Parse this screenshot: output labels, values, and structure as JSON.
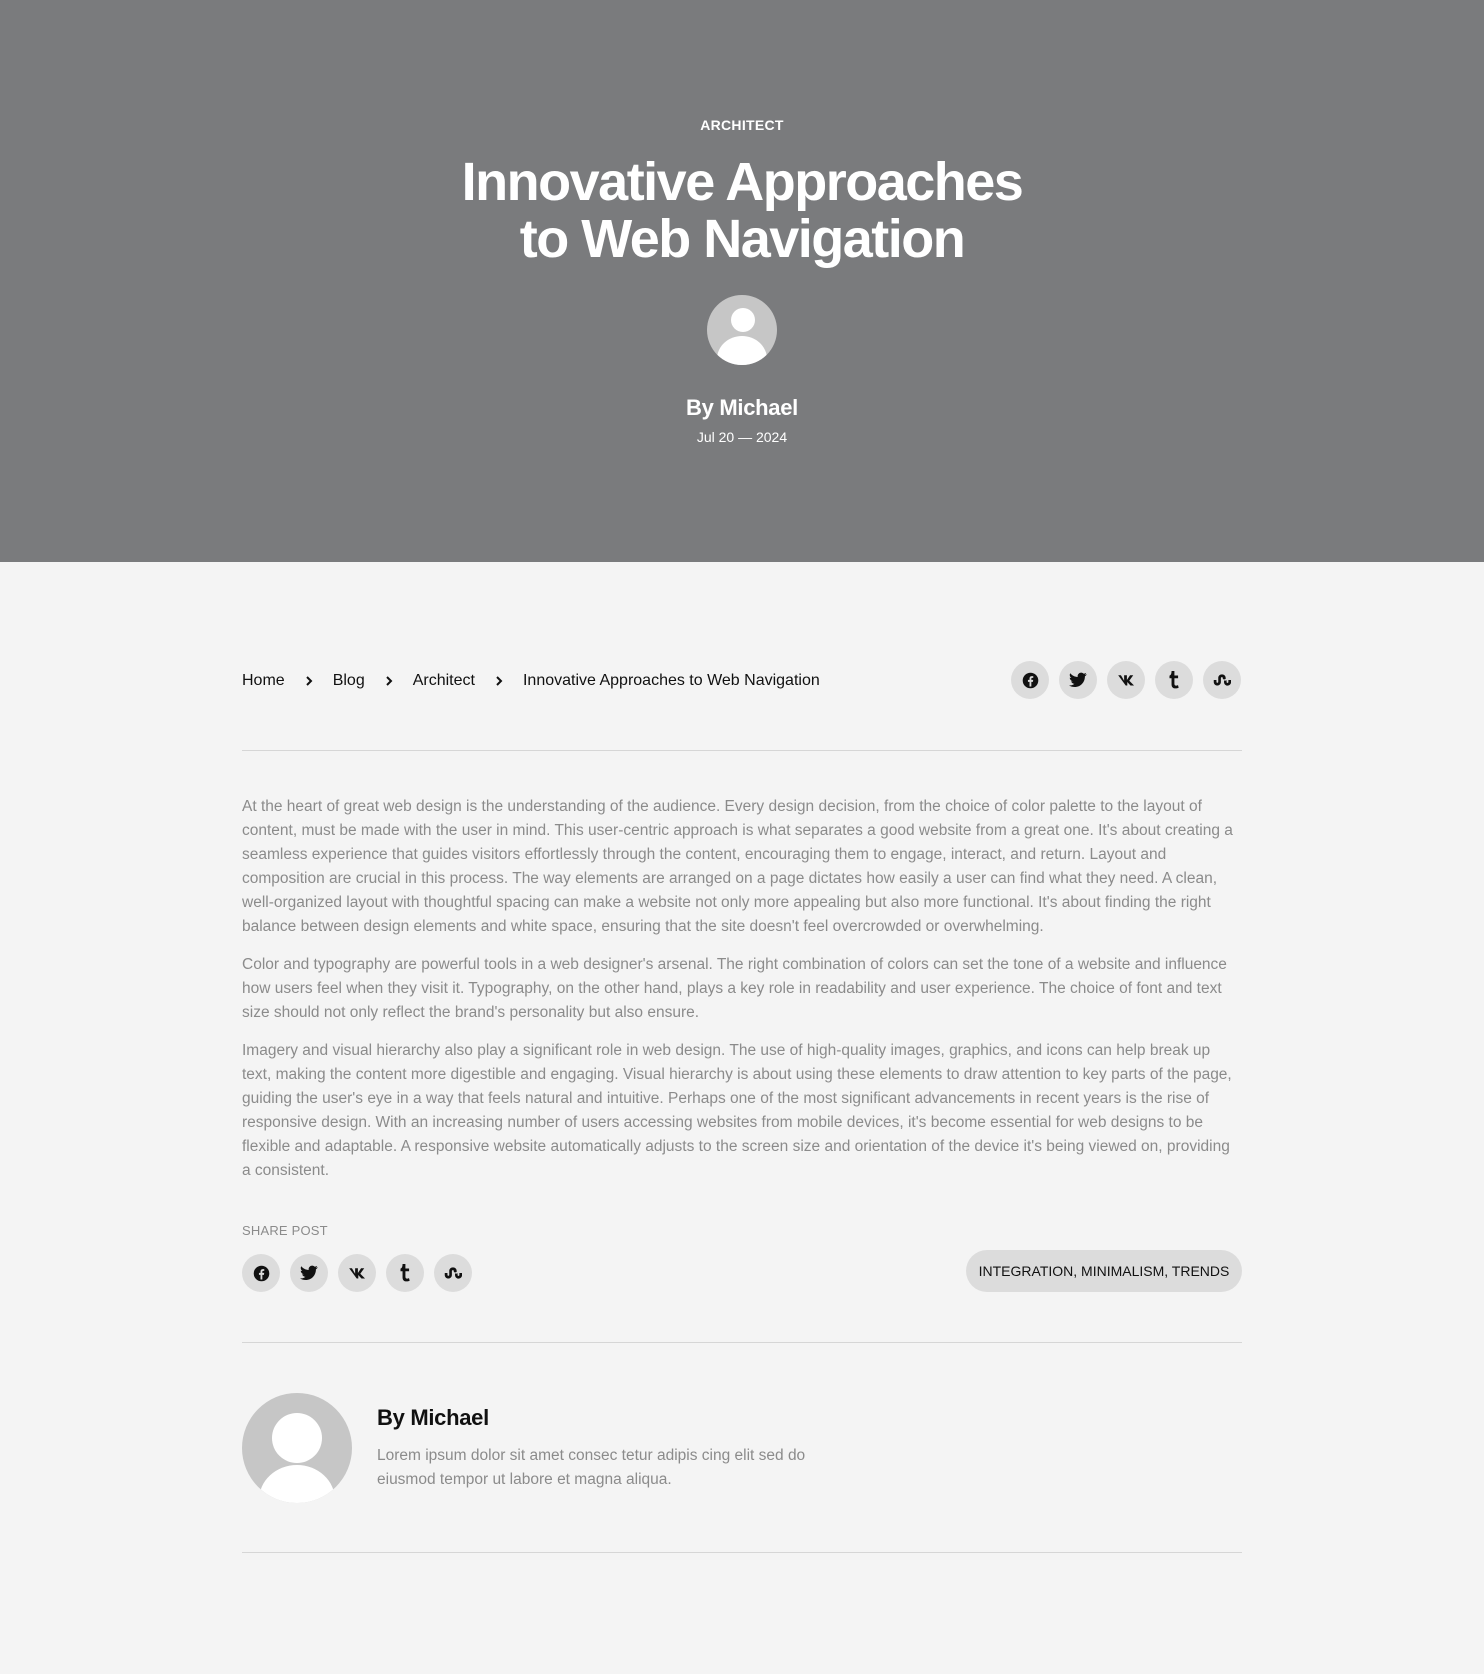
{
  "hero": {
    "category": "ARCHITECT",
    "title": "Innovative Approaches to Web Navigation",
    "author": "By Michael",
    "date": "Jul 20 — 2024"
  },
  "breadcrumb": {
    "items": [
      "Home",
      "Blog",
      "Architect",
      "Innovative Approaches to Web Navigation"
    ]
  },
  "share_icons": [
    "facebook-icon",
    "twitter-icon",
    "vk-icon",
    "tumblr-icon",
    "stumbleupon-icon"
  ],
  "article": {
    "paragraphs": [
      "At the heart of great web design is the understanding of the audience. Every design decision, from the choice of color palette to the layout of content, must be made with the user in mind. This user-centric approach is what separates a good website from a great one. It's about creating a seamless experience that guides visitors effortlessly through the content, encouraging them to engage, interact, and return. Layout and composition are crucial in this process. The way elements are arranged on a page dictates how easily a user can find what they need. A clean, well-organized layout with thoughtful spacing can make a website not only more appealing but also more functional. It's about finding the right balance between design elements and white space, ensuring that the site doesn't feel overcrowded or overwhelming.",
      "Color and typography are powerful tools in a web designer's arsenal. The right combination of colors can set the tone of a website and influence how users feel when they visit it. Typography, on the other hand, plays a key role in readability and user experience. The choice of font and text size should not only reflect the brand's personality but also ensure.",
      "Imagery and visual hierarchy also play a significant role in web design. The use of high-quality images, graphics, and icons can help break up text, making the content more digestible and engaging. Visual hierarchy is about using these elements to draw attention to key parts of the page, guiding the user's eye in a way that feels natural and intuitive. Perhaps one of the most significant advancements in recent years is the rise of responsive design. With an increasing number of users accessing websites from mobile devices, it's become essential for web designs to be flexible and adaptable. A responsive website automatically adjusts to the screen size and orientation of the device it's being viewed on, providing a consistent."
    ]
  },
  "share": {
    "label": "SHARE POST",
    "tags": "INTEGRATION, MINIMALISM, TRENDS"
  },
  "author_box": {
    "name": "By Michael",
    "bio": "Lorem ipsum dolor sit amet consec tetur adipis cing elit sed do eiusmod tempor ut labore et magna aliqua."
  },
  "colors": {
    "hero_bg": "#7a7b7d",
    "page_bg": "#f4f4f4",
    "avatar_bg": "#c6c6c6",
    "button_bg": "#dcdcdc",
    "body_text": "#8b8b8b"
  }
}
